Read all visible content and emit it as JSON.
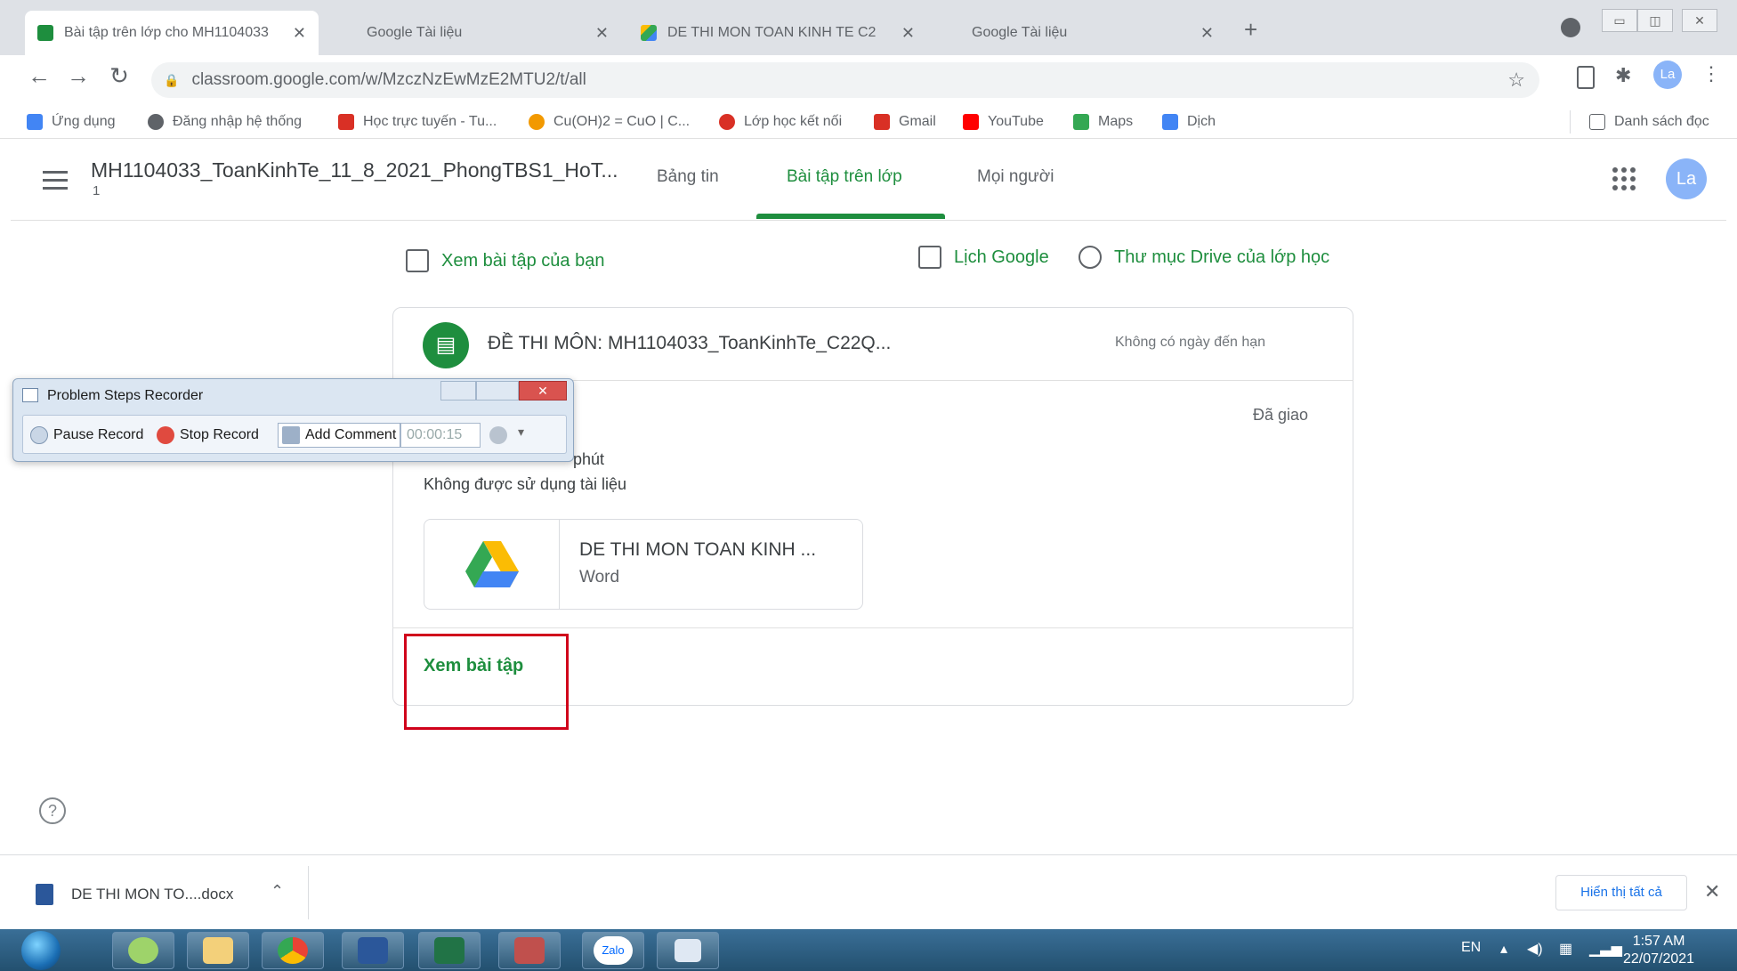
{
  "browser": {
    "tabs": [
      {
        "title": "Bài tập trên lớp cho MH1104033",
        "active": true,
        "icon": "classroom-icon",
        "color": "#1e8e3e"
      },
      {
        "title": "Google Tài liệu",
        "active": false,
        "icon": "docs-icon",
        "color": "#4285f4"
      },
      {
        "title": "DE THI MON TOAN KINH TE C2",
        "active": false,
        "icon": "drive-icon",
        "color": "#fbbc04"
      },
      {
        "title": "Google Tài liệu",
        "active": false,
        "icon": "docs-icon",
        "color": "#4285f4"
      }
    ],
    "new_tab": "+",
    "url": "classroom.google.com/w/MzczNzEwMzE2MTU2/t/all",
    "profile_initials": "La",
    "bookmarks": [
      {
        "label": "Ứng dụng",
        "icon": "apps-icon",
        "color": "#4285f4"
      },
      {
        "label": "Đăng nhập hệ thống",
        "icon": "globe-icon",
        "color": "#5f6368"
      },
      {
        "label": "Học trực tuyến - Tu...",
        "icon": "dollar-icon",
        "color": "#d93025"
      },
      {
        "label": "Cu(OH)2 = CuO | C...",
        "icon": "refresh-icon",
        "color": "#f29900"
      },
      {
        "label": "Lớp học kết nối",
        "icon": "school-icon",
        "color": "#d93025"
      },
      {
        "label": "Gmail",
        "icon": "gmail-icon",
        "color": "#d93025"
      },
      {
        "label": "YouTube",
        "icon": "youtube-icon",
        "color": "#ff0000"
      },
      {
        "label": "Maps",
        "icon": "maps-icon",
        "color": "#34a853"
      },
      {
        "label": "Dịch",
        "icon": "translate-icon",
        "color": "#4285f4"
      }
    ],
    "reading_list": "Danh sách đọc"
  },
  "classroom": {
    "course_title": "MH1104033_ToanKinhTe_11_8_2021_PhongTBS1_HoT...",
    "course_section": "1",
    "nav_tabs": [
      "Bảng tin",
      "Bài tập trên lớp",
      "Mọi người"
    ],
    "selected_tab": "Bài tập trên lớp",
    "account_initials": "La",
    "view_your_work": "Xem bài tập của bạn",
    "google_calendar": "Lịch Google",
    "drive_folder": "Thư mục Drive của lớp học",
    "assignment": {
      "title": "ĐỀ THI MÔN: MH1104033_ToanKinhTe_C22Q...",
      "due": "Không có ngày đến hạn",
      "status": "Đã giao",
      "description_line1": "phút",
      "description_line2": "Không được sử dụng tài liệu",
      "attachment_name": "DE THI MON TOAN KINH ...",
      "attachment_type": "Word",
      "view_button": "Xem bài tập"
    }
  },
  "recorder": {
    "title": "Problem Steps Recorder",
    "pause": "Pause Record",
    "stop": "Stop Record",
    "comment": "Add Comment",
    "timer": "00:00:15"
  },
  "downloads": {
    "file": "DE THI MON TO....docx",
    "show_all": "Hiển thị tất cả"
  },
  "taskbar": {
    "zalo": "Zalo",
    "lang": "EN",
    "time": "1:57 AM",
    "date": "22/07/2021"
  }
}
